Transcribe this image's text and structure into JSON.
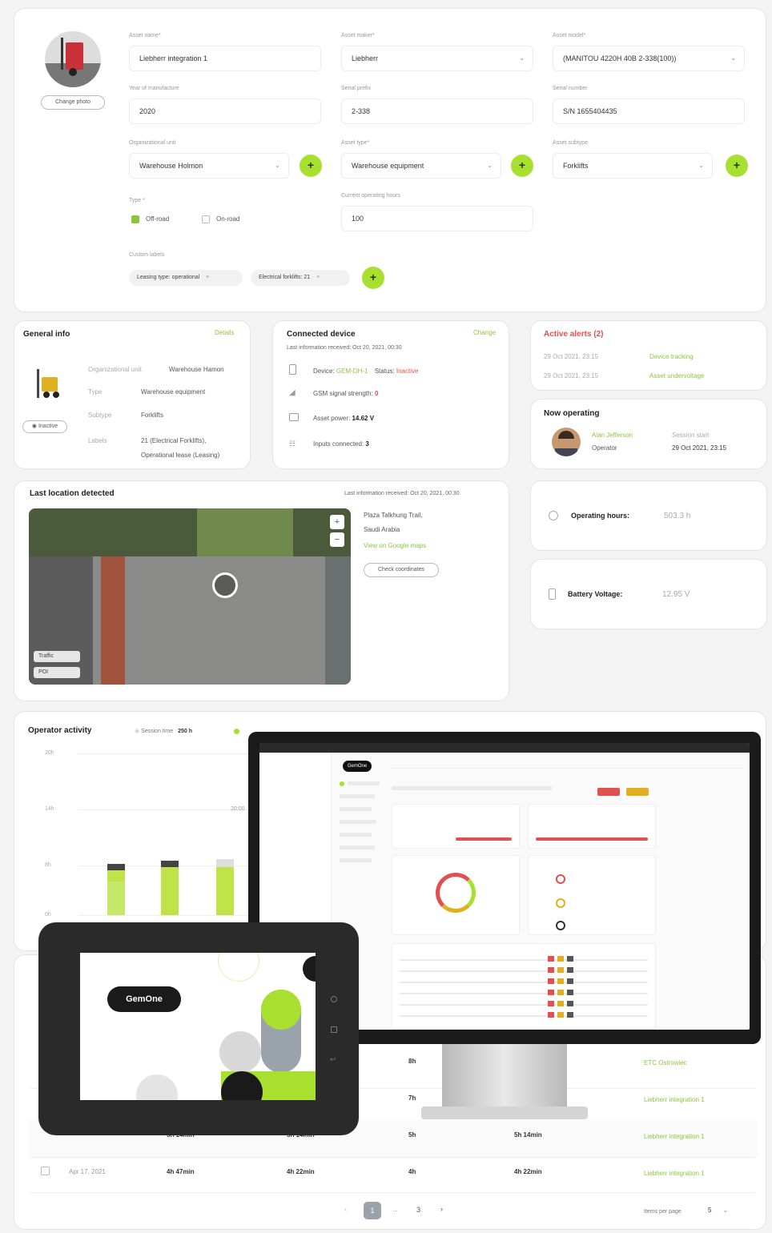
{
  "form": {
    "change_photo": "Change photo",
    "asset_name": {
      "label": "Asset name*",
      "value": "Liebherr integration 1"
    },
    "asset_maker": {
      "label": "Asset maker*",
      "value": "Liebherr"
    },
    "asset_model": {
      "label": "Asset model*",
      "value": "(MANITOU 4220H 40B 2-338(100))"
    },
    "year": {
      "label": "Year of manufacture",
      "value": "2020"
    },
    "serial_prefix": {
      "label": "Serial prefix",
      "value": "2-338"
    },
    "serial_number": {
      "label": "Serial number",
      "value": "S/N 1655404435"
    },
    "org_unit": {
      "label": "Organizational unit",
      "value": "Warehouse Holmon"
    },
    "asset_type": {
      "label": "Asset type*",
      "value": "Warehouse equipment"
    },
    "asset_subtype": {
      "label": "Asset subtype",
      "value": "Forklifts"
    },
    "type": {
      "label": "Type *",
      "option1": "Off-road",
      "option2": "On-road"
    },
    "operating_hours": {
      "label": "Current operating hours",
      "value": "100"
    },
    "custom_labels": {
      "label": "Custom labels",
      "chip1": "Leasing type: operational",
      "chip2": "Electrical forklifts: 21"
    }
  },
  "general_info": {
    "title": "General info",
    "details_link": "Details",
    "status": "Inactive",
    "rows": [
      {
        "k": "Organizational unit",
        "v": "Warehouse Hamon"
      },
      {
        "k": "Type",
        "v": "Warehouse equipment"
      },
      {
        "k": "Subtype",
        "v": "Forklifts"
      },
      {
        "k": "Labels",
        "v": "21 (Electrical Forklifts),"
      },
      {
        "k": "",
        "v": "Operational lease (Leasing)"
      }
    ]
  },
  "connected_device": {
    "title": "Connected device",
    "change_link": "Change",
    "last_info": "Last information received: Oct 20, 2021, 00:30",
    "device_label": "Device:",
    "device_value": "GEM-DH-1",
    "status_label": "Status:",
    "status_value": "Inactive",
    "gsm_label": "GSM signal strength:",
    "gsm_value": "0",
    "power_label": "Asset power:",
    "power_value": "14.62 V",
    "inputs_label": "Inputs connected:",
    "inputs_value": "3"
  },
  "alerts": {
    "title": "Active alerts (2)",
    "items": [
      {
        "date": "29 Oct 2021, 23:15",
        "text": "Device tracking"
      },
      {
        "date": "29 Oct 2021, 23:15",
        "text": "Asset undervoltage"
      }
    ]
  },
  "now_operating": {
    "title": "Now operating",
    "name": "Alan Jefferson",
    "role": "Operator",
    "session_label": "Session start",
    "session_value": "29 Oct 2021, 23:15"
  },
  "location": {
    "title": "Last location detected",
    "last_info": "Last information received: Oct 20, 2021, 00:30",
    "address1": "Plaza Talkhung Trail,",
    "address2": "Saudi Arabia",
    "maps_link": "View on Google maps",
    "coords_button": "Check coordinates",
    "traffic": "Traffic",
    "poi": "POI"
  },
  "operating_hours": {
    "label": "Operating hours:",
    "value": "503.3 h"
  },
  "battery": {
    "label": "Battery Voltage:",
    "value": "12.95 V"
  },
  "operator_activity": {
    "title": "Operator activity",
    "session_label": "Session time",
    "session_value": "250 h",
    "yticks": [
      "20h",
      "14h",
      "8h",
      "0h"
    ],
    "popup_time": "20:00"
  },
  "table": {
    "rows": [
      {
        "c1": "",
        "c2": "",
        "c3": "",
        "c4": "8h",
        "c5": "",
        "c6": "ETC Ostrowiec"
      },
      {
        "c1": "",
        "c2": "",
        "c3": "",
        "c4": "7h",
        "c5": "",
        "c6": "Liebherr integration 1"
      },
      {
        "c1": "",
        "c2": "5h 14min",
        "c3": "5h 14min",
        "c4": "5h",
        "c5": "5h 14min",
        "c6": "Liebherr integration 1"
      },
      {
        "c1": "Apr 17, 2021",
        "c2": "4h 47min",
        "c3": "4h 22min",
        "c4": "4h",
        "c5": "4h 22min",
        "c6": "Liebherr integration 1"
      }
    ],
    "pagination": {
      "current": "1",
      "dots": "...",
      "last": "3"
    },
    "items_per_page_label": "Items per page",
    "items_per_page_value": "5"
  },
  "tablet": {
    "logo": "GemOne"
  },
  "monitor": {
    "logo": "GemOne"
  },
  "colors": {
    "accent": "#a8e030",
    "accent_text": "#8cc63f",
    "alert": "#e05050"
  }
}
